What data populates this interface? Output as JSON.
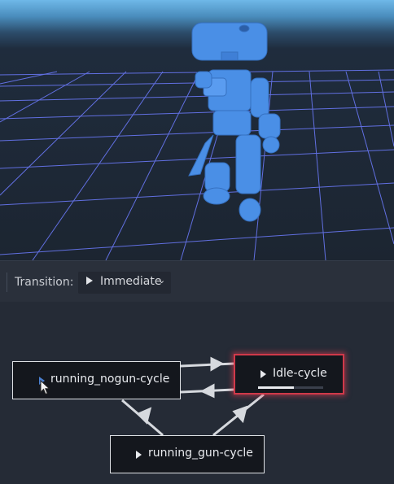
{
  "toolbar": {
    "transition_label": "Transition:",
    "transition_mode": "Immediate",
    "chevron_icon": "chevron-down-icon"
  },
  "graph": {
    "nodes": [
      {
        "id": "running_nogun",
        "label": "running_nogun-cycle",
        "selected": false
      },
      {
        "id": "idle",
        "label": "Idle-cycle",
        "selected": true,
        "playback_progress": 0.55
      },
      {
        "id": "running_gun",
        "label": "running_gun-cycle",
        "selected": false
      }
    ]
  },
  "colors": {
    "grid_line": "#6d7cff",
    "character": "#4a8fe6",
    "selection": "#d0394a",
    "node_bg": "#14171d",
    "panel_bg": "#252b36"
  }
}
